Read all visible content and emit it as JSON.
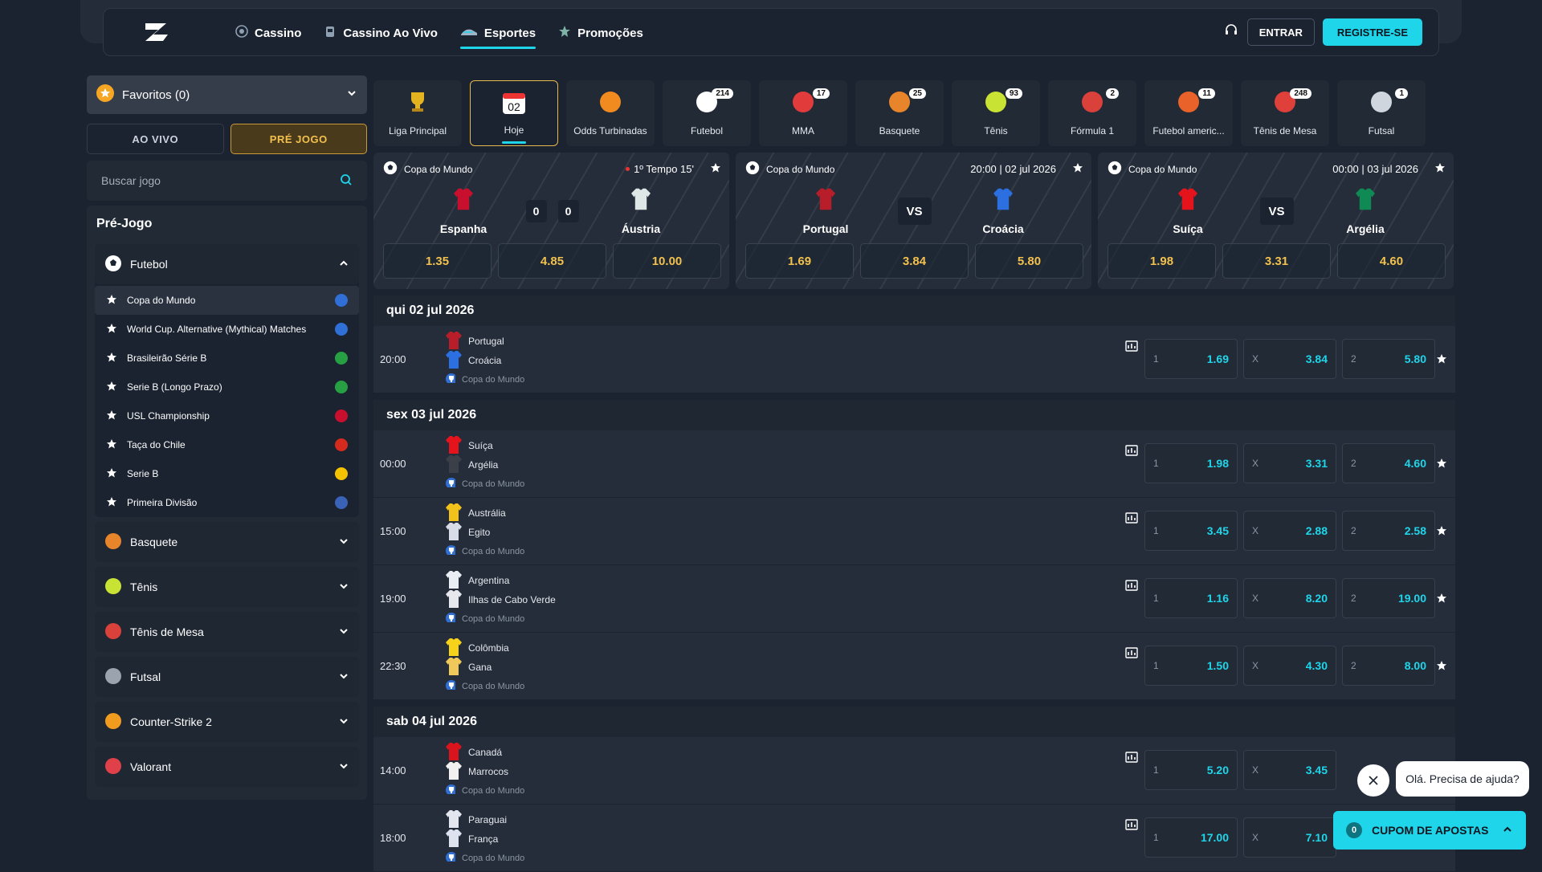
{
  "nav": {
    "items": [
      {
        "label": "Cassino",
        "icon": "casino-chip-icon"
      },
      {
        "label": "Cassino Ao Vivo",
        "icon": "live-casino-icon"
      },
      {
        "label": "Esportes",
        "icon": "sports-shoe-icon",
        "active": true
      },
      {
        "label": "Promoções",
        "icon": "promotions-icon"
      }
    ],
    "login_label": "ENTRAR",
    "register_label": "REGISTRE-SE"
  },
  "sidebar": {
    "favorites_label": "Favoritos (0)",
    "live_label": "AO VIVO",
    "pre_label": "PRÉ JOGO",
    "search_placeholder": "Buscar jogo",
    "section_title": "Pré-Jogo",
    "open_sport": "Futebol",
    "leagues": [
      {
        "name": "Copa do Mundo",
        "flag": "#2f6fd6"
      },
      {
        "name": "World Cup. Alternative (Mythical) Matches",
        "flag": "#2f6fd6"
      },
      {
        "name": "Brasileirão Série B",
        "flag": "#27a043"
      },
      {
        "name": "Serie B (Longo Prazo)",
        "flag": "#27a043"
      },
      {
        "name": "USL Championship",
        "flag": "#c8102e"
      },
      {
        "name": "Taça do Chile",
        "flag": "#d52b1e"
      },
      {
        "name": "Serie B",
        "flag": "#f4c300"
      },
      {
        "name": "Primeira Divisão",
        "flag": "#3a63b8"
      }
    ],
    "sports": [
      {
        "name": "Basquete",
        "color": "#e8842a"
      },
      {
        "name": "Tênis",
        "color": "#c9e335"
      },
      {
        "name": "Tênis de Mesa",
        "color": "#d9413a"
      },
      {
        "name": "Futsal",
        "color": "#9aa3ae"
      },
      {
        "name": "Counter-Strike 2",
        "color": "#f29c1f"
      },
      {
        "name": "Valorant",
        "color": "#e0404a"
      }
    ]
  },
  "categories": [
    {
      "label": "Liga Principal",
      "count": ""
    },
    {
      "label": "Hoje",
      "count": "",
      "day": "02"
    },
    {
      "label": "Odds Turbinadas",
      "count": ""
    },
    {
      "label": "Futebol",
      "count": "214"
    },
    {
      "label": "MMA",
      "count": "17"
    },
    {
      "label": "Basquete",
      "count": "25"
    },
    {
      "label": "Tênis",
      "count": "93"
    },
    {
      "label": "Fórmula 1",
      "count": "2"
    },
    {
      "label": "Futebol americ...",
      "count": "11"
    },
    {
      "label": "Tênis de Mesa",
      "count": "248"
    },
    {
      "label": "Futsal",
      "count": "1"
    }
  ],
  "featured": [
    {
      "league": "Copa do Mundo",
      "time": "1º Tempo 15'",
      "live": true,
      "home": "Espanha",
      "away": "Áustria",
      "home_score": "0",
      "away_score": "0",
      "odds": [
        "1.35",
        "4.85",
        "10.00"
      ],
      "home_color": "#c8102e",
      "away_color": "#dfe6e6"
    },
    {
      "league": "Copa do Mundo",
      "time": "20:00 | 02 jul 2026",
      "vs": "VS",
      "home": "Portugal",
      "away": "Croácia",
      "odds": [
        "1.69",
        "3.84",
        "5.80"
      ],
      "home_color": "#b81d2a",
      "away_color": "#2b6fe0"
    },
    {
      "league": "Copa do Mundo",
      "time": "00:00 | 03 jul 2026",
      "vs": "VS",
      "home": "Suíça",
      "away": "Argélia",
      "odds": [
        "1.98",
        "3.31",
        "4.60"
      ],
      "home_color": "#e5141c",
      "away_color": "#0f8a54"
    }
  ],
  "days": [
    {
      "label": "qui 02 jul 2026",
      "matches": [
        {
          "time": "20:00",
          "home": "Portugal",
          "away": "Croácia",
          "league": "Copa do Mundo",
          "odds": [
            "1.69",
            "3.84",
            "5.80"
          ],
          "hc": "#b81d2a",
          "ac": "#2b6fe0"
        }
      ]
    },
    {
      "label": "sex 03 jul 2026",
      "matches": [
        {
          "time": "00:00",
          "home": "Suíça",
          "away": "Argélia",
          "league": "Copa do Mundo",
          "odds": [
            "1.98",
            "3.31",
            "4.60"
          ],
          "hc": "#e5141c",
          "ac": "#3a3f48"
        },
        {
          "time": "15:00",
          "home": "Austrália",
          "away": "Egito",
          "league": "Copa do Mundo",
          "odds": [
            "3.45",
            "2.88",
            "2.58"
          ],
          "hc": "#f2c21a",
          "ac": "#d8dce6"
        },
        {
          "time": "19:00",
          "home": "Argentina",
          "away": "Ilhas de Cabo Verde",
          "league": "Copa do Mundo",
          "odds": [
            "1.16",
            "8.20",
            "19.00"
          ],
          "hc": "#e9eef5",
          "ac": "#e6e8ee"
        },
        {
          "time": "22:30",
          "home": "Colômbia",
          "away": "Gana",
          "league": "Copa do Mundo",
          "odds": [
            "1.50",
            "4.30",
            "8.00"
          ],
          "hc": "#f6d21a",
          "ac": "#f0c95a"
        }
      ]
    },
    {
      "label": "sab 04 jul 2026",
      "matches": [
        {
          "time": "14:00",
          "home": "Canadá",
          "away": "Marrocos",
          "league": "Copa do Mundo",
          "odds": [
            "5.20",
            "3.45",
            ""
          ],
          "hc": "#d9141c",
          "ac": "#f1f1f1"
        },
        {
          "time": "18:00",
          "home": "Paraguai",
          "away": "França",
          "league": "Copa do Mundo",
          "odds": [
            "17.00",
            "7.10",
            ""
          ],
          "hc": "#e4e6ef",
          "ac": "#dde2ee"
        }
      ]
    }
  ],
  "odds_labels": [
    "1",
    "X",
    "2"
  ],
  "chat": {
    "message": "Olá. Precisa de ajuda?"
  },
  "coupon": {
    "count": "0",
    "label": "CUPOM DE APOSTAS"
  }
}
